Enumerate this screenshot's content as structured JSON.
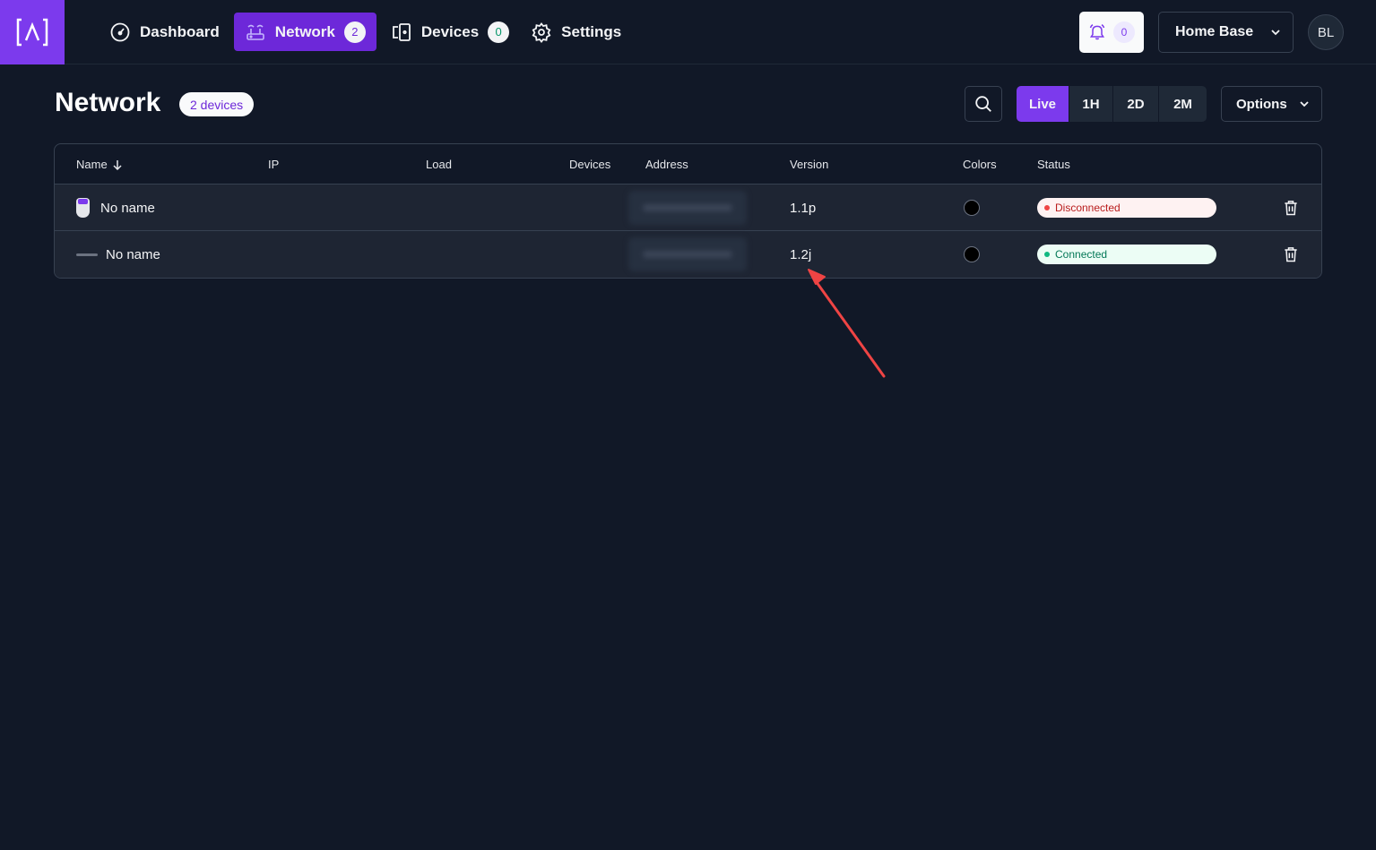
{
  "nav": {
    "items": [
      {
        "label": "Dashboard",
        "icon": "dashboard-gauge-icon"
      },
      {
        "label": "Network",
        "icon": "router-icon",
        "badge": "2",
        "active": true
      },
      {
        "label": "Devices",
        "icon": "devices-icon",
        "badge": "0"
      },
      {
        "label": "Settings",
        "icon": "gear-icon"
      }
    ]
  },
  "topbar": {
    "notifications_count": "0",
    "base_select": "Home Base",
    "avatar_initials": "BL"
  },
  "page": {
    "title": "Network",
    "devices_badge": "2 devices",
    "ranges": [
      "Live",
      "1H",
      "2D",
      "2M"
    ],
    "active_range": "Live",
    "options_label": "Options"
  },
  "table": {
    "columns": [
      "Name",
      "IP",
      "Load",
      "Devices",
      "Address",
      "Version",
      "Colors",
      "Status"
    ],
    "sort_column": "Name",
    "rows": [
      {
        "name": "No name",
        "icon": "pro-device-icon",
        "version": "1.1p",
        "status": "Disconnected"
      },
      {
        "name": "No name",
        "icon": "strip-device-icon",
        "version": "1.2j",
        "status": "Connected"
      }
    ]
  },
  "colors": {
    "accent": "#7c3aed",
    "background": "#111827",
    "disconnected": "#ef4444",
    "connected": "#10b981"
  }
}
